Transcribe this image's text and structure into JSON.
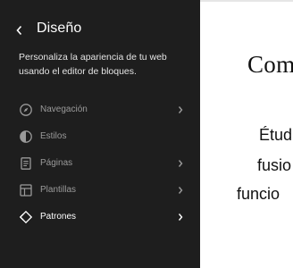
{
  "sidebar": {
    "title": "Diseño",
    "description": "Personaliza la apariencia de tu web usando el editor de bloques.",
    "items": [
      {
        "label": "Navegación",
        "icon": "compass-icon",
        "has_chevron": true
      },
      {
        "label": "Estilos",
        "icon": "half-circle-icon",
        "has_chevron": false
      },
      {
        "label": "Páginas",
        "icon": "page-icon",
        "has_chevron": true
      },
      {
        "label": "Plantillas",
        "icon": "layout-icon",
        "has_chevron": true
      },
      {
        "label": "Patrones",
        "icon": "symbol-icon",
        "has_chevron": true,
        "active": true
      }
    ]
  },
  "preview": {
    "heading": "Com",
    "lines": [
      "Étud",
      "fusio",
      "funcio"
    ]
  },
  "colors": {
    "sidebar_bg": "#1e1e1e",
    "text_active": "#ffffff",
    "text_muted": "#9a9a9a",
    "preview_bg": "#ffffff"
  }
}
